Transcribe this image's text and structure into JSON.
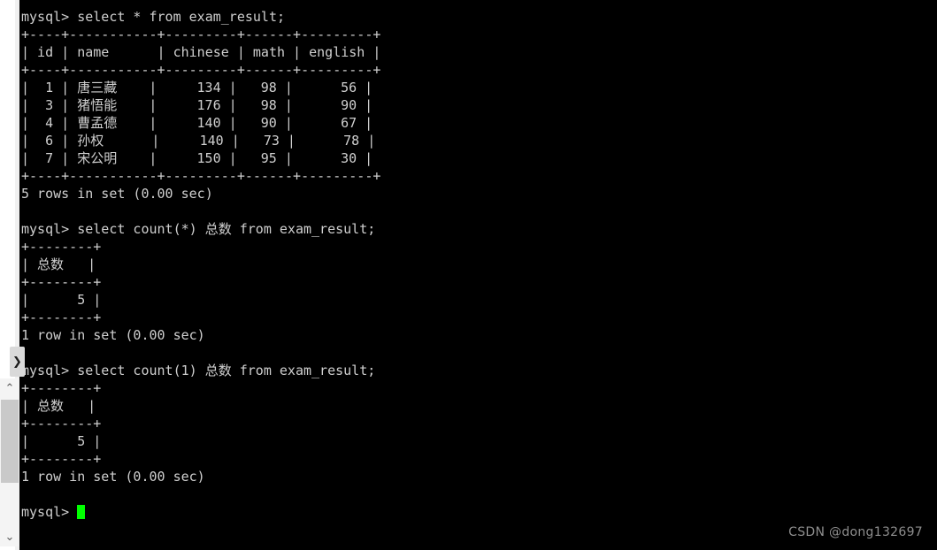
{
  "window": {
    "background_color": "#000000",
    "text_color": "#cfcfcf",
    "cursor_color": "#00ff00"
  },
  "scrollbar": {
    "expander_icon": "❯",
    "up_icon": "⌃",
    "down_icon": "⌄"
  },
  "watermark": {
    "text": "CSDN @dong132697"
  },
  "terminal": {
    "prompt": "mysql> ",
    "lines": [
      {
        "id": "l01",
        "text": "mysql> select * from exam_result;"
      },
      {
        "id": "l02",
        "text": "+----+-----------+---------+------+---------+"
      },
      {
        "id": "l03",
        "text": "| id | name      | chinese | math | english |"
      },
      {
        "id": "l04",
        "text": "+----+-----------+---------+------+---------+"
      },
      {
        "id": "l05",
        "text": "|  1 | 唐三藏    |     134 |   98 |      56 |"
      },
      {
        "id": "l06",
        "text": "|  3 | 猪悟能    |     176 |   98 |      90 |"
      },
      {
        "id": "l07",
        "text": "|  4 | 曹孟德    |     140 |   90 |      67 |"
      },
      {
        "id": "l08",
        "text": "|  6 | 孙权      |     140 |   73 |      78 |"
      },
      {
        "id": "l09",
        "text": "|  7 | 宋公明    |     150 |   95 |      30 |"
      },
      {
        "id": "l10",
        "text": "+----+-----------+---------+------+---------+"
      },
      {
        "id": "l11",
        "text": "5 rows in set (0.00 sec)"
      },
      {
        "id": "l12",
        "text": ""
      },
      {
        "id": "l13",
        "text": "mysql> select count(*) 总数 from exam_result;"
      },
      {
        "id": "l14",
        "text": "+--------+"
      },
      {
        "id": "l15",
        "text": "| 总数   |"
      },
      {
        "id": "l16",
        "text": "+--------+"
      },
      {
        "id": "l17",
        "text": "|      5 |"
      },
      {
        "id": "l18",
        "text": "+--------+"
      },
      {
        "id": "l19",
        "text": "1 row in set (0.00 sec)"
      },
      {
        "id": "l20",
        "text": ""
      },
      {
        "id": "l21",
        "text": "mysql> select count(1) 总数 from exam_result;"
      },
      {
        "id": "l22",
        "text": "+--------+"
      },
      {
        "id": "l23",
        "text": "| 总数   |"
      },
      {
        "id": "l24",
        "text": "+--------+"
      },
      {
        "id": "l25",
        "text": "|      5 |"
      },
      {
        "id": "l26",
        "text": "+--------+"
      },
      {
        "id": "l27",
        "text": "1 row in set (0.00 sec)"
      },
      {
        "id": "l28",
        "text": ""
      }
    ],
    "last_prompt": "mysql> "
  },
  "query_results": {
    "exam_result": {
      "columns": [
        "id",
        "name",
        "chinese",
        "math",
        "english"
      ],
      "rows": [
        [
          1,
          "唐三藏",
          134,
          98,
          56
        ],
        [
          3,
          "猪悟能",
          176,
          98,
          90
        ],
        [
          4,
          "曹孟德",
          140,
          90,
          67
        ],
        [
          6,
          "孙权",
          140,
          73,
          78
        ],
        [
          7,
          "宋公明",
          150,
          95,
          30
        ]
      ],
      "status": "5 rows in set (0.00 sec)"
    },
    "count_star": {
      "columns": [
        "总数"
      ],
      "rows": [
        [
          5
        ]
      ],
      "status": "1 row in set (0.00 sec)"
    },
    "count_one": {
      "columns": [
        "总数"
      ],
      "rows": [
        [
          5
        ]
      ],
      "status": "1 row in set (0.00 sec)"
    }
  }
}
